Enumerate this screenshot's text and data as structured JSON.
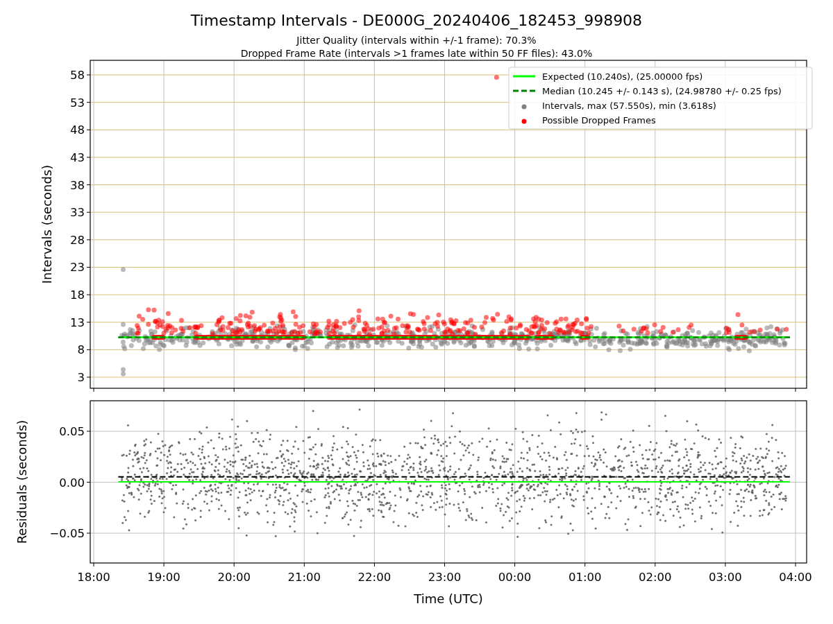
{
  "figure": {
    "title": "Timestamp Intervals - DE000G_20240406_182453_998908",
    "subtitles": [
      "Jitter Quality (intervals within +/-1 frame): 70.3%",
      "Dropped Frame Rate (intervals >1 frames late within 50 FF files): 43.0%"
    ]
  },
  "top_panel": {
    "y_axis_label": "Intervals (seconds)",
    "y_tick_labels": [
      "58",
      "53",
      "48",
      "43",
      "38",
      "33",
      "28",
      "23",
      "18",
      "13",
      "8",
      "3"
    ],
    "legend": [
      {
        "label": "Expected (10.240s), (25.00000 fps)",
        "kind": "line",
        "color": "#00ff00"
      },
      {
        "label": "Median (10.245 +/- 0.143 s), (24.98780 +/- 0.25 fps)",
        "kind": "dashed",
        "color": "#008000"
      },
      {
        "label": "Intervals, max (57.550s), min (3.618s)",
        "kind": "dots",
        "color": "#808080"
      },
      {
        "label": "Possible Dropped Frames",
        "kind": "dots",
        "color": "#ff0000"
      }
    ]
  },
  "bottom_panel": {
    "y_axis_label": "Residuals (seconds)",
    "y_tick_labels": [
      "0.05",
      "0.00",
      "−0.05"
    ],
    "x_axis_label": "Time (UTC)",
    "x_tick_labels": [
      "18:00",
      "19:00",
      "20:00",
      "21:00",
      "22:00",
      "23:00",
      "00:00",
      "01:00",
      "02:00",
      "03:00",
      "04:00"
    ]
  }
}
